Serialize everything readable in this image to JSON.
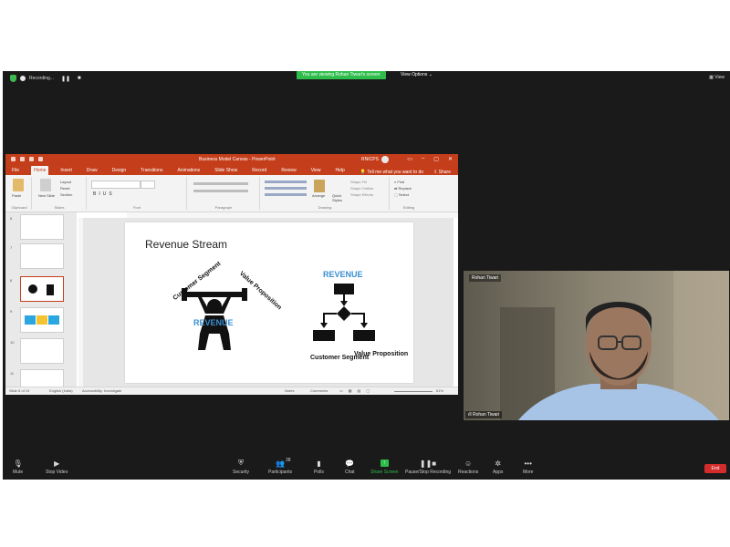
{
  "zoom": {
    "recording_label": "Recording...",
    "banner": "You are viewing Rohan Tiwari's screen",
    "view_options": "View Options",
    "view_label": "View"
  },
  "ppt": {
    "doc_title": "Business Model Canvas  -  PowerPoint",
    "user": "RNICPS",
    "tabs": [
      "File",
      "Home",
      "Insert",
      "Draw",
      "Design",
      "Transitions",
      "Animations",
      "Slide Show",
      "Record",
      "Review",
      "View",
      "Help"
    ],
    "tell_me": "Tell me what you want to do",
    "share": "Share",
    "ribbon": {
      "paste": "Paste",
      "new_slide": "New Slide",
      "layout": "Layout",
      "reset": "Reset",
      "section": "Section",
      "arrange": "Arrange",
      "quick_styles": "Quick Styles",
      "shape_fill": "Shape Fill",
      "shape_outline": "Shape Outline",
      "shape_effects": "Shape Effects",
      "find": "Find",
      "replace": "Replace",
      "select": "Select",
      "groups": [
        "Clipboard",
        "Slides",
        "Font",
        "Paragraph",
        "Drawing",
        "Editing"
      ]
    },
    "slide": {
      "title": "Revenue Stream",
      "left_diagram": {
        "label1": "Customer Segment",
        "label2": "Value Proposition",
        "center": "REVENUE"
      },
      "right_diagram": {
        "top": "REVENUE",
        "bottom_left": "Customer Segment",
        "bottom_right": "Value Proposition"
      }
    },
    "thumbnails": [
      6,
      7,
      8,
      9,
      10,
      11
    ],
    "selected_slide": 8,
    "status": {
      "slide_of": "Slide 8 of 19",
      "language": "English (India)",
      "accessibility": "Accessibility: Investigate",
      "notes": "Notes",
      "comments": "Comments",
      "zoom": "61%"
    }
  },
  "video": {
    "top_name": "Rohan Tiwari",
    "bottom_name": "Rohan Tiwari"
  },
  "toolbar": {
    "mute": "Mute",
    "stop_video": "Stop Video",
    "security": "Security",
    "participants": "Participants",
    "participants_count": "38",
    "polls": "Polls",
    "chat": "Chat",
    "share_screen": "Share Screen",
    "pause_recording": "Pause/Stop Recording",
    "reactions": "Reactions",
    "apps": "Apps",
    "more": "More",
    "end": "End"
  }
}
